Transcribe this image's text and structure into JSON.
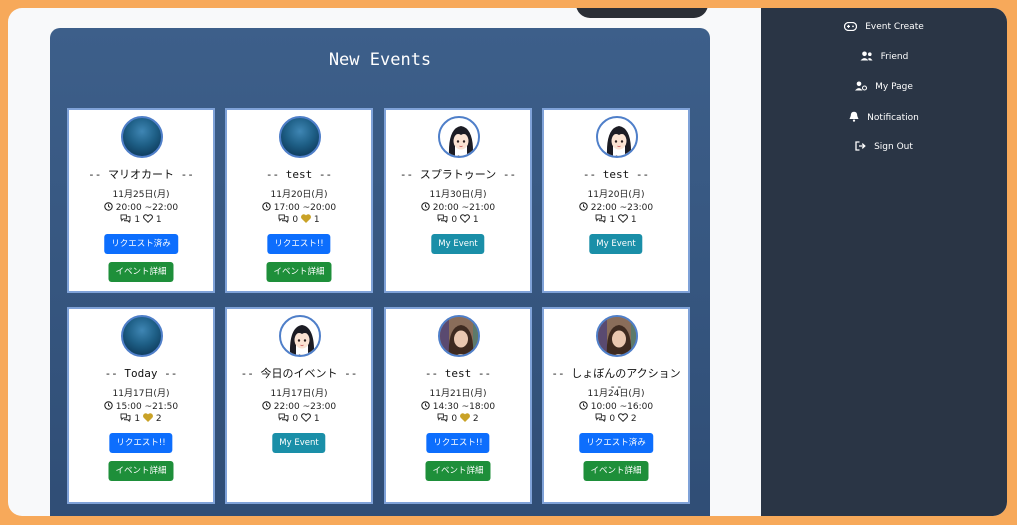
{
  "page": {
    "title": "New Events"
  },
  "sidebar": {
    "items": [
      {
        "label": "Event Create",
        "icon": "gamepad-icon"
      },
      {
        "label": "Friend",
        "icon": "users-icon"
      },
      {
        "label": "My Page",
        "icon": "user-gear-icon"
      },
      {
        "label": "Notification",
        "icon": "bell-icon"
      },
      {
        "label": "Sign Out",
        "icon": "sign-out-icon"
      }
    ]
  },
  "colors": {
    "panel": "#3d5f8a",
    "card_border": "#7fa2d8",
    "sidebar": "#2a3545",
    "button_primary": "#0d6efd",
    "button_info": "#1a8fa8",
    "button_success": "#1e8f3a",
    "heart_liked": "#c9a227"
  },
  "events": [
    {
      "title": "-- マリオカート --",
      "date": "11月25日(月)",
      "time": "20:00 ~22:00",
      "comments": "1",
      "likes": "1",
      "liked": false,
      "avatar": "ocean",
      "action_label": "リクエスト済み",
      "action_type": "primary",
      "detail_label": "イベント詳細"
    },
    {
      "title": "-- test --",
      "date": "11月20日(月)",
      "time": "17:00 ~20:00",
      "comments": "0",
      "likes": "1",
      "liked": true,
      "avatar": "ocean",
      "action_label": "リクエスト!!",
      "action_type": "primary",
      "detail_label": "イベント詳細"
    },
    {
      "title": "-- スプラトゥーン --",
      "date": "11月30日(月)",
      "time": "20:00 ~21:00",
      "comments": "0",
      "likes": "1",
      "liked": false,
      "avatar": "girl",
      "action_label": "My Event",
      "action_type": "info",
      "detail_label": ""
    },
    {
      "title": "-- test --",
      "date": "11月20日(月)",
      "time": "22:00 ~23:00",
      "comments": "1",
      "likes": "1",
      "liked": false,
      "avatar": "girl",
      "action_label": "My Event",
      "action_type": "info",
      "detail_label": ""
    },
    {
      "title": "-- Today     --",
      "date": "11月17日(月)",
      "time": "15:00 ~21:50",
      "comments": "1",
      "likes": "2",
      "liked": true,
      "avatar": "ocean",
      "action_label": "リクエスト!!",
      "action_type": "primary",
      "detail_label": "イベント詳細"
    },
    {
      "title": "-- 今日のイベント --",
      "date": "11月17日(月)",
      "time": "22:00 ~23:00",
      "comments": "0",
      "likes": "1",
      "liked": false,
      "avatar": "girl",
      "action_label": "My Event",
      "action_type": "info",
      "detail_label": ""
    },
    {
      "title": "-- test --",
      "date": "11月21日(月)",
      "time": "14:30 ~18:00",
      "comments": "0",
      "likes": "2",
      "liked": true,
      "avatar": "photo",
      "action_label": "リクエスト!!",
      "action_type": "primary",
      "detail_label": "イベント詳細"
    },
    {
      "title": "-- しょぼんのアクション --",
      "date": "11月24日(月)",
      "time": "10:00 ~16:00",
      "comments": "0",
      "likes": "2",
      "liked": false,
      "avatar": "photo",
      "action_label": "リクエスト済み",
      "action_type": "primary",
      "detail_label": "イベント詳細"
    }
  ]
}
